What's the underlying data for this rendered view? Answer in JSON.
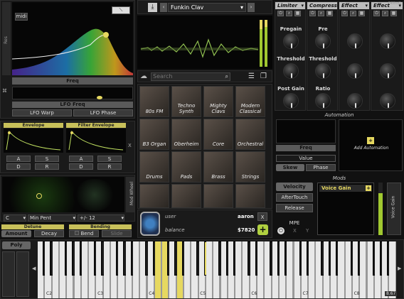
{
  "preset": {
    "name": "Funkin Clav"
  },
  "filter": {
    "type_label": "midi",
    "res_label": "Res",
    "freq_label": "Freq",
    "lfo_freq_label": "LFO Freq",
    "lfo_warp_label": "LFO Warp",
    "lfo_phase_label": "LFO Phase"
  },
  "envelopes": {
    "envelope_label": "Envelope",
    "filter_env_label": "Filter Envelope",
    "a": "A",
    "s": "S",
    "d": "D",
    "r": "R"
  },
  "modwheel": {
    "label": "Mod Wheel",
    "key_value": "C",
    "scale_value": "Min Pent",
    "range_value": "+/- 12"
  },
  "detune": {
    "section": "Detune",
    "amount": "Amount",
    "decay": "Decay"
  },
  "bending": {
    "section": "Bending",
    "bend": "Bend",
    "slide": "Slide"
  },
  "search": {
    "placeholder": "Search"
  },
  "browser_tiles": [
    "80s FM",
    "Techno Synth",
    "Mighty Clavs",
    "Modern Classical",
    "B3 Organ",
    "Oberheim",
    "Core",
    "Orchestral",
    "Drums",
    "Pads",
    "Brass",
    "Strings"
  ],
  "account": {
    "user_label": "user",
    "user_value": "aaron",
    "balance_label": "balance",
    "balance_value": "$7820",
    "close": "X",
    "add": "+"
  },
  "effects": [
    {
      "name": "Limiter",
      "knobs": [
        "Pregain",
        "Threshold",
        "Post Gain"
      ]
    },
    {
      "name": "Compressor",
      "knobs": [
        "Pre",
        "Threshold",
        "Ratio"
      ]
    },
    {
      "name": "Effect",
      "knobs": [
        "",
        "",
        ""
      ]
    },
    {
      "name": "Effect",
      "knobs": [
        "",
        "",
        ""
      ]
    }
  ],
  "automation": {
    "title": "Automation",
    "freq": "Freq",
    "value": "Value",
    "skew": "Skew",
    "phase": "Phase",
    "add": "Add Automation"
  },
  "mods": {
    "title": "Mods",
    "velocity": "Velocity",
    "aftertouch": "AfterTouch",
    "release": "Release",
    "mpe": "MPE",
    "x": "X",
    "y": "Y",
    "voice_gain": "Voice Gain",
    "voice_gain_vertical": "Voice Gain"
  },
  "keyboard": {
    "poly": "Poly",
    "labels": [
      "C2",
      "C3",
      "C4",
      "C5",
      "C6",
      "C7",
      "C8"
    ],
    "corner": "8.67"
  },
  "misc": {
    "debug": "DEBUG",
    "x_small": "X"
  },
  "colors": {
    "accent_yellow": "#e6d860",
    "green_meter": "#a0c830"
  }
}
